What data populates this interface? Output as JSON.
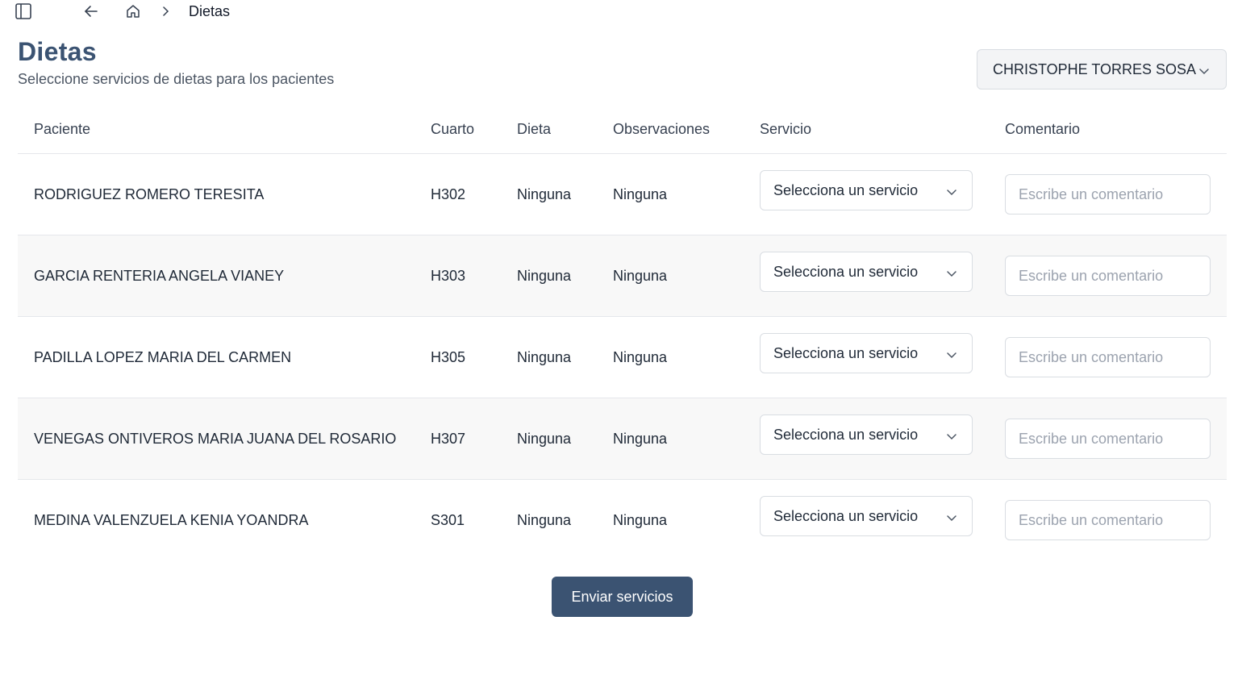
{
  "topbar": {
    "breadcrumb_current": "Dietas",
    "icons": [
      "sidebar-toggle-icon",
      "arrow-left-icon",
      "home-icon",
      "chevron-right-icon"
    ]
  },
  "header": {
    "title": "Dietas",
    "subtitle": "Seleccione servicios de dietas para los pacientes",
    "user_name": "CHRISTOPHE TORRES SOSA"
  },
  "table": {
    "columns": {
      "paciente": "Paciente",
      "cuarto": "Cuarto",
      "dieta": "Dieta",
      "observaciones": "Observaciones",
      "servicio": "Servicio",
      "comentario": "Comentario"
    },
    "service_placeholder": "Selecciona un servicio",
    "comment_placeholder": "Escribe un comentario",
    "rows": [
      {
        "paciente": "RODRIGUEZ ROMERO TERESITA",
        "cuarto": "H302",
        "dieta": "Ninguna",
        "observaciones": "Ninguna",
        "comentario": ""
      },
      {
        "paciente": "GARCIA RENTERIA ANGELA VIANEY",
        "cuarto": "H303",
        "dieta": "Ninguna",
        "observaciones": "Ninguna",
        "comentario": ""
      },
      {
        "paciente": "PADILLA LOPEZ MARIA DEL CARMEN",
        "cuarto": "H305",
        "dieta": "Ninguna",
        "observaciones": "Ninguna",
        "comentario": ""
      },
      {
        "paciente": "VENEGAS ONTIVEROS MARIA JUANA DEL ROSARIO",
        "cuarto": "H307",
        "dieta": "Ninguna",
        "observaciones": "Ninguna",
        "comentario": ""
      },
      {
        "paciente": "MEDINA VALENZUELA KENIA YOANDRA",
        "cuarto": "S301",
        "dieta": "Ninguna",
        "observaciones": "Ninguna",
        "comentario": ""
      }
    ]
  },
  "actions": {
    "submit_label": "Enviar servicios"
  },
  "colors": {
    "primary": "#3b5372",
    "row_alt": "#f8f8f8",
    "border": "#d9dde2"
  }
}
